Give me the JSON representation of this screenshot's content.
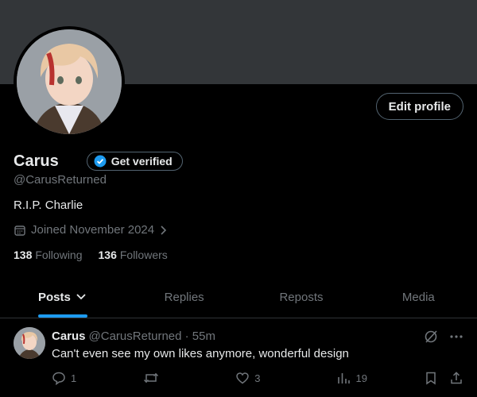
{
  "profile": {
    "display_name": "Carus",
    "handle": "@CarusReturned",
    "verify_label": "Get verified",
    "edit_label": "Edit profile",
    "bio": "R.I.P. Charlie",
    "joined": "Joined November 2024",
    "following_count": "138",
    "following_label": "Following",
    "followers_count": "136",
    "followers_label": "Followers"
  },
  "tabs": [
    {
      "label": "Posts",
      "active": true
    },
    {
      "label": "Replies"
    },
    {
      "label": "Reposts"
    },
    {
      "label": "Media"
    }
  ],
  "post": {
    "name": "Carus",
    "meta": "@CarusReturned · 55m",
    "text": "Can't even see my own likes anymore, wonderful design",
    "replies": "1",
    "likes": "3",
    "views": "19"
  },
  "colors": {
    "background": "#000000",
    "banner": "#333639",
    "accent": "#1d9bf0",
    "muted_text": "#71767b"
  },
  "icons": [
    "calendar-icon",
    "chevron-right-icon",
    "verified-badge-icon",
    "chevron-down-icon",
    "grok-icon",
    "more-icon",
    "reply-icon",
    "repost-icon",
    "like-icon",
    "views-icon",
    "bookmark-icon",
    "share-icon"
  ]
}
